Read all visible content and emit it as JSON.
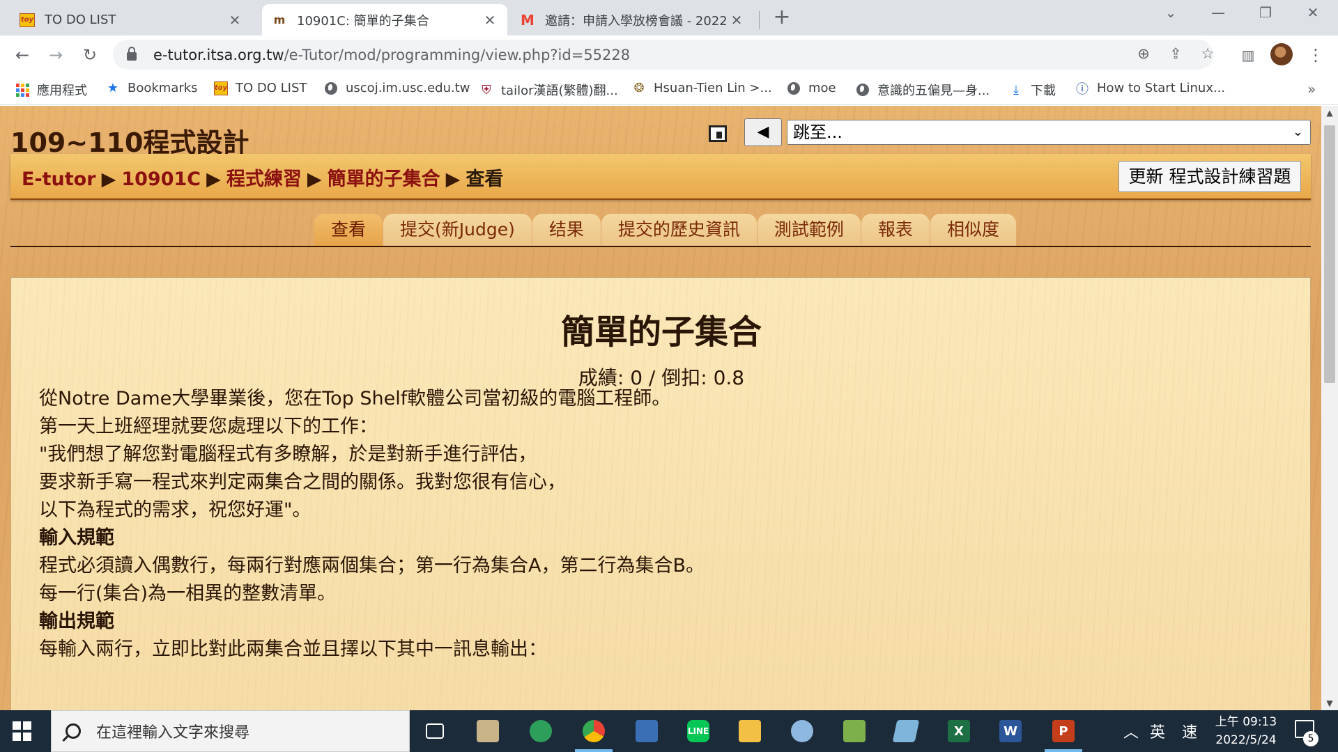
{
  "browser": {
    "tabs": [
      {
        "title": "TO DO LIST",
        "favicon": "toy-favicon-icon",
        "active": false
      },
      {
        "title": "10901C: 簡單的子集合",
        "favicon": "moodle-favicon-icon",
        "active": true
      },
      {
        "title": "邀請：申請入學放榜會議 - 2022",
        "favicon": "gmail-favicon-icon",
        "active": false
      }
    ],
    "url_domain": "e-tutor.itsa.org.tw",
    "url_path": "/e-Tutor/mod/programming/view.php?id=55228",
    "bookmarks": [
      {
        "label": "應用程式",
        "icon": "apps-grid-icon"
      },
      {
        "label": "Bookmarks",
        "icon": "star-icon"
      },
      {
        "label": "TO DO LIST",
        "icon": "toy-favicon-icon"
      },
      {
        "label": "uscoj.im.usc.edu.tw",
        "icon": "globe-icon"
      },
      {
        "label": "tailor漢語(繁體)翻...",
        "icon": "crest-icon"
      },
      {
        "label": "Hsuan-Tien Lin >...",
        "icon": "seal-icon"
      },
      {
        "label": "moe",
        "icon": "globe-icon"
      },
      {
        "label": "意識的五偏見—身...",
        "icon": "globe-icon"
      },
      {
        "label": "下載",
        "icon": "download-icon"
      },
      {
        "label": "How to Start Linux...",
        "icon": "info-shield-icon"
      }
    ]
  },
  "page": {
    "course_title": "109~110程式設計",
    "jump_placeholder": "跳至...",
    "prev_label": "◀",
    "breadcrumb": [
      "E-tutor",
      "10901C",
      "程式練習",
      "簡單的子集合",
      "查看"
    ],
    "breadcrumb_sep": "▶",
    "update_button": "更新 程式設計練習題",
    "tabs": [
      "查看",
      "提交(新Judge)",
      "结果",
      "提交的歷史資訊",
      "測試範例",
      "報表",
      "相似度"
    ],
    "active_tab": 0,
    "problem_title": "簡單的子集合",
    "score_line": "成績: 0 / 倒扣: 0.8",
    "lines": [
      {
        "text": "從Notre Dame大學畢業後，您在Top Shelf軟體公司當初級的電腦工程師。",
        "heading": false
      },
      {
        "text": "第一天上班經理就要您處理以下的工作：",
        "heading": false
      },
      {
        "text": "\"我們想了解您對電腦程式有多瞭解，於是對新手進行評估，",
        "heading": false
      },
      {
        "text": "要求新手寫一程式來判定兩集合之間的關係。我對您很有信心，",
        "heading": false
      },
      {
        "text": "以下為程式的需求，祝您好運\"。",
        "heading": false
      },
      {
        "text": "輸入規範",
        "heading": true
      },
      {
        "text": "程式必須讀入偶數行，每兩行對應兩個集合；第一行為集合A，第二行為集合B。",
        "heading": false
      },
      {
        "text": "每一行(集合)為一相異的整數清單。",
        "heading": false
      },
      {
        "text": "輸出規範",
        "heading": true
      },
      {
        "text": "每輸入兩行，立即比對此兩集合並且擇以下其中一訊息輸出：",
        "heading": false
      }
    ]
  },
  "taskbar": {
    "search_placeholder": "在這裡輸入文字來搜尋",
    "ime_lang": "英",
    "ime_mode": "速",
    "time": "上午 09:13",
    "date": "2022/5/24",
    "notification_count": "5"
  },
  "colors": {
    "breadcrumb_link": "#8b1010",
    "tab_text": "#7a2a08",
    "content_bg": "#fbe8b9",
    "wood": "#e2a862"
  }
}
